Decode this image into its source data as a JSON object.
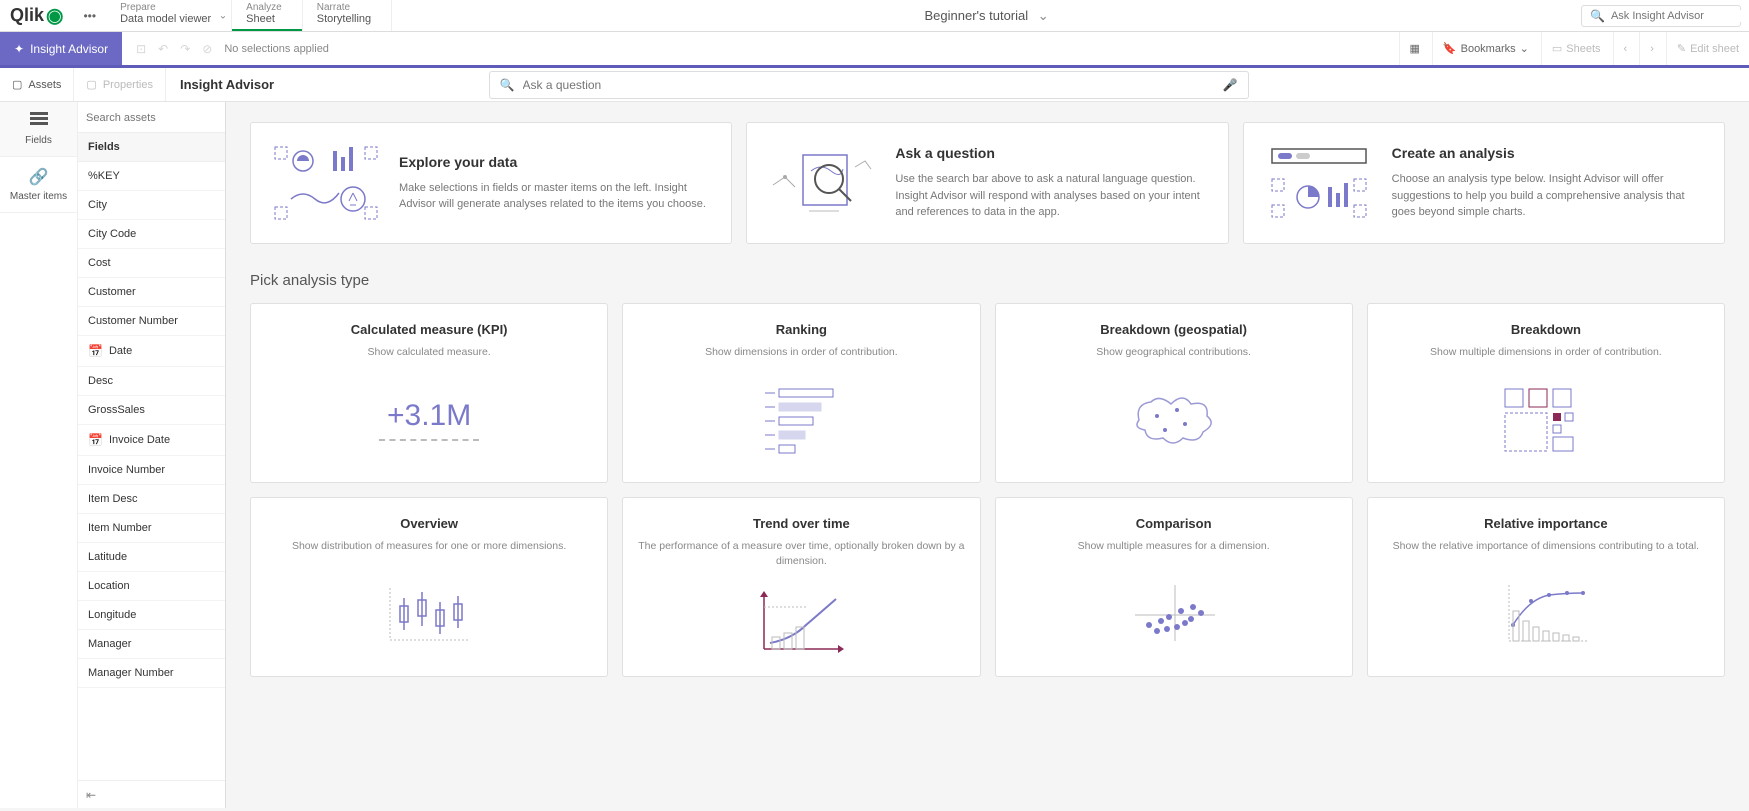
{
  "top": {
    "logo": "Qlik",
    "nav": [
      {
        "sub": "Prepare",
        "main": "Data model viewer",
        "hasDropdown": true
      },
      {
        "sub": "Analyze",
        "main": "Sheet",
        "active": true
      },
      {
        "sub": "Narrate",
        "main": "Storytelling"
      }
    ],
    "app_title": "Beginner's tutorial",
    "search_placeholder": "Ask Insight Advisor"
  },
  "selbar": {
    "insight_label": "Insight Advisor",
    "no_selections": "No selections applied",
    "bookmarks": "Bookmarks",
    "sheets": "Sheets",
    "edit": "Edit sheet"
  },
  "subheader": {
    "assets": "Assets",
    "properties": "Properties",
    "title": "Insight Advisor",
    "ask_placeholder": "Ask a question"
  },
  "leftrail": {
    "fields": "Fields",
    "master": "Master items"
  },
  "fields_panel": {
    "search_placeholder": "Search assets",
    "header": "Fields",
    "items": [
      {
        "label": "%KEY"
      },
      {
        "label": "City"
      },
      {
        "label": "City Code"
      },
      {
        "label": "Cost"
      },
      {
        "label": "Customer"
      },
      {
        "label": "Customer Number"
      },
      {
        "label": "Date",
        "icon": "date"
      },
      {
        "label": "Desc"
      },
      {
        "label": "GrossSales"
      },
      {
        "label": "Invoice Date",
        "icon": "date"
      },
      {
        "label": "Invoice Number"
      },
      {
        "label": "Item Desc"
      },
      {
        "label": "Item Number"
      },
      {
        "label": "Latitude"
      },
      {
        "label": "Location"
      },
      {
        "label": "Longitude"
      },
      {
        "label": "Manager"
      },
      {
        "label": "Manager Number"
      }
    ]
  },
  "intro": [
    {
      "title": "Explore your data",
      "body": "Make selections in fields or master items on the left. Insight Advisor will generate analyses related to the items you choose."
    },
    {
      "title": "Ask a question",
      "body": "Use the search bar above to ask a natural language question. Insight Advisor will respond with analyses based on your intent and references to data in the app."
    },
    {
      "title": "Create an analysis",
      "body": "Choose an analysis type below. Insight Advisor will offer suggestions to help you build a comprehensive analysis that goes beyond simple charts."
    }
  ],
  "section_title": "Pick analysis type",
  "analysis": [
    {
      "title": "Calculated measure (KPI)",
      "desc": "Show calculated measure.",
      "kpi": "+3.1M"
    },
    {
      "title": "Ranking",
      "desc": "Show dimensions in order of contribution."
    },
    {
      "title": "Breakdown (geospatial)",
      "desc": "Show geographical contributions."
    },
    {
      "title": "Breakdown",
      "desc": "Show multiple dimensions in order of contribution."
    },
    {
      "title": "Overview",
      "desc": "Show distribution of measures for one or more dimensions."
    },
    {
      "title": "Trend over time",
      "desc": "The performance of a measure over time, optionally broken down by a dimension."
    },
    {
      "title": "Comparison",
      "desc": "Show multiple measures for a dimension."
    },
    {
      "title": "Relative importance",
      "desc": "Show the relative importance of dimensions contributing to a total."
    }
  ]
}
